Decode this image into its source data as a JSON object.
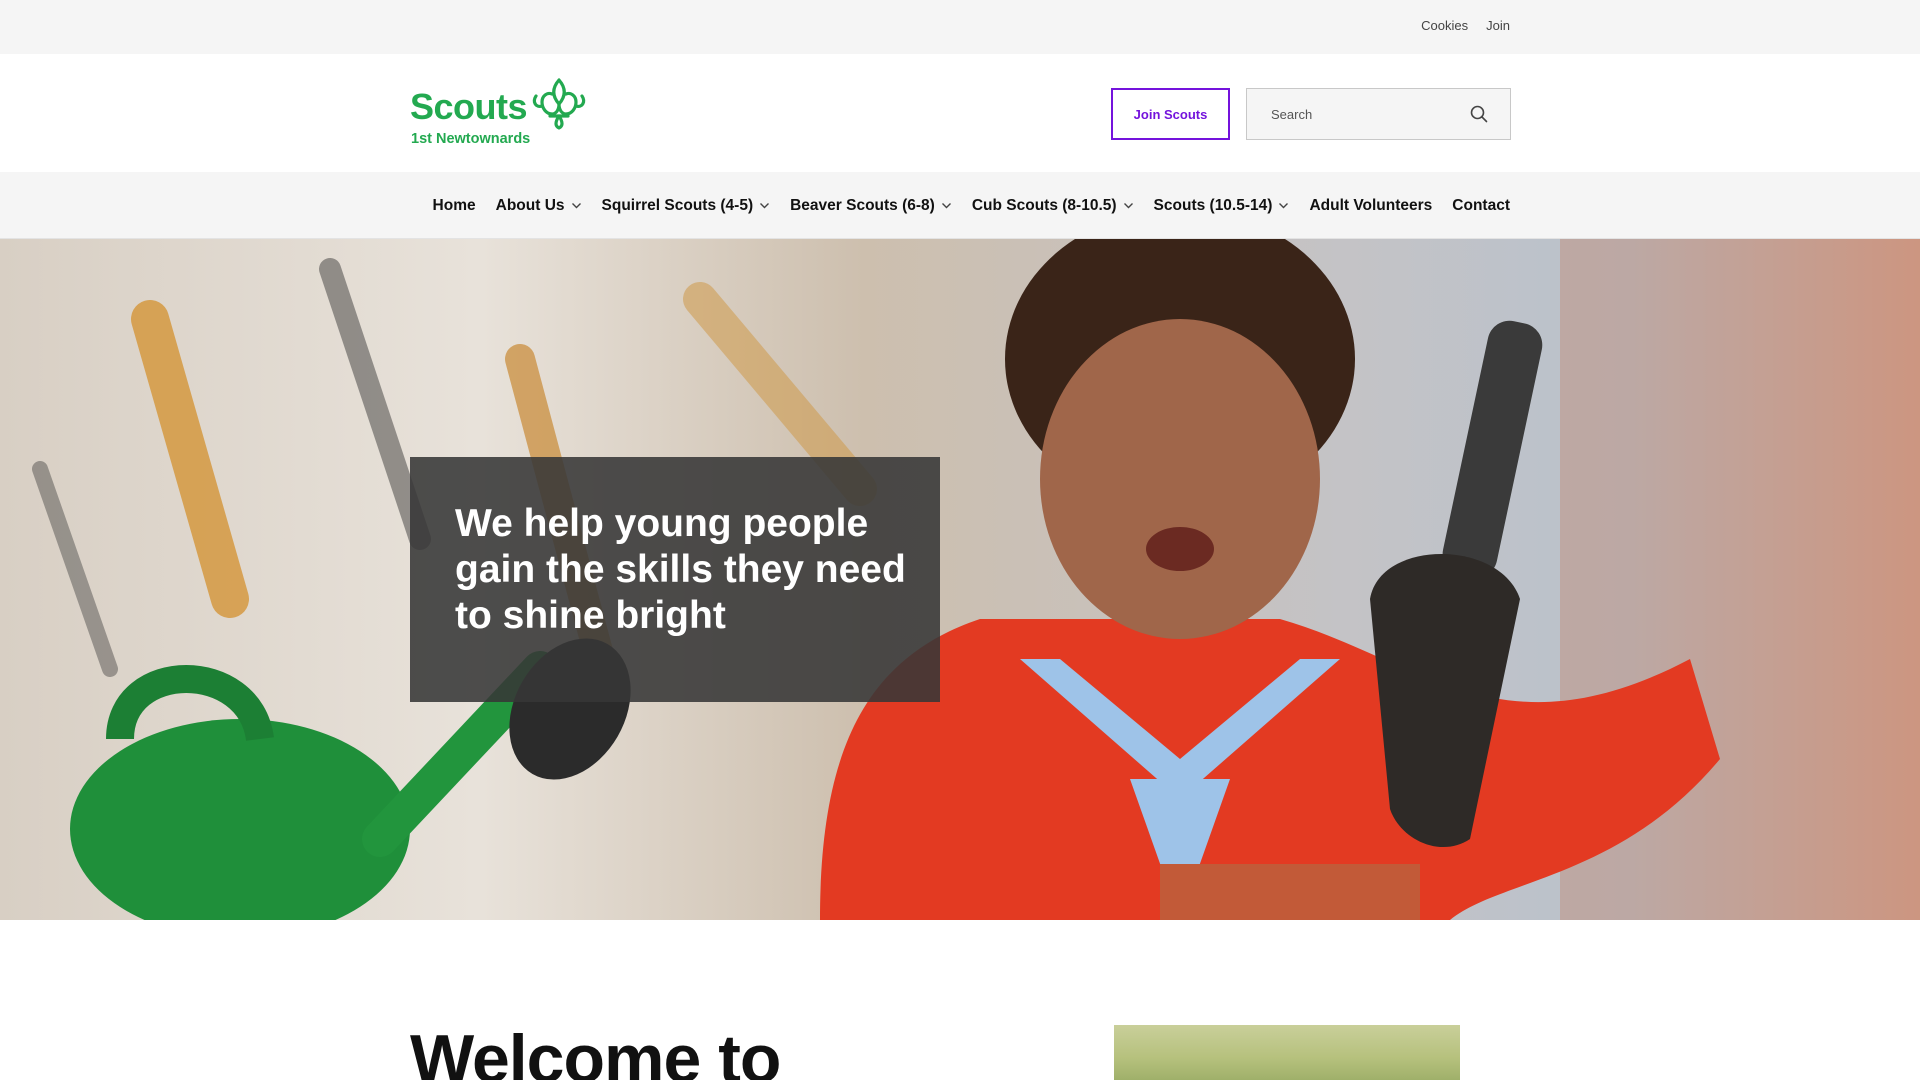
{
  "topbar": {
    "links": [
      "Cookies",
      "Join"
    ]
  },
  "header": {
    "logo_word": "Scouts",
    "logo_sub": "1st Newtownards",
    "join_button": "Join Scouts",
    "search_placeholder": "Search"
  },
  "nav": {
    "items": [
      {
        "label": "Home",
        "dropdown": false
      },
      {
        "label": "About Us",
        "dropdown": true
      },
      {
        "label": "Squirrel Scouts (4-5)",
        "dropdown": true
      },
      {
        "label": "Beaver Scouts (6-8)",
        "dropdown": true
      },
      {
        "label": "Cub Scouts (8-10.5)",
        "dropdown": true
      },
      {
        "label": "Scouts (10.5-14)",
        "dropdown": true
      },
      {
        "label": "Adult Volunteers",
        "dropdown": false
      },
      {
        "label": "Contact",
        "dropdown": false
      }
    ]
  },
  "hero": {
    "headline": "We help young people gain the skills they need to shine bright"
  },
  "main": {
    "welcome_heading": "Welcome to"
  },
  "colors": {
    "brand_green": "#23a950",
    "brand_purple": "#7413dc",
    "hero_box": "#373737"
  }
}
